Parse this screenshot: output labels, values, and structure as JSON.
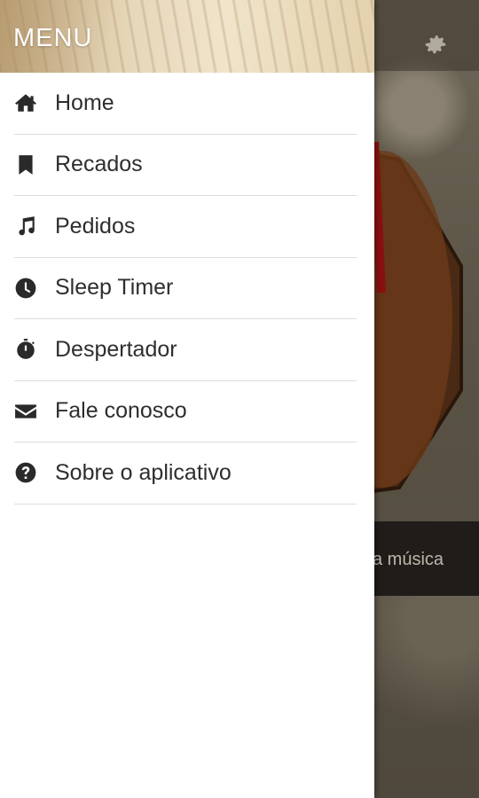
{
  "drawer": {
    "title": "MENU",
    "items": [
      {
        "label": "Home",
        "icon": "home-icon"
      },
      {
        "label": "Recados",
        "icon": "bookmark-icon"
      },
      {
        "label": "Pedidos",
        "icon": "music-note-icon"
      },
      {
        "label": "Sleep Timer",
        "icon": "clock-icon"
      },
      {
        "label": "Despertador",
        "icon": "stopwatch-icon"
      },
      {
        "label": "Fale conosco",
        "icon": "envelope-icon"
      },
      {
        "label": "Sobre o aplicativo",
        "icon": "question-circle-icon"
      }
    ]
  },
  "background": {
    "bar_text": "a música"
  }
}
